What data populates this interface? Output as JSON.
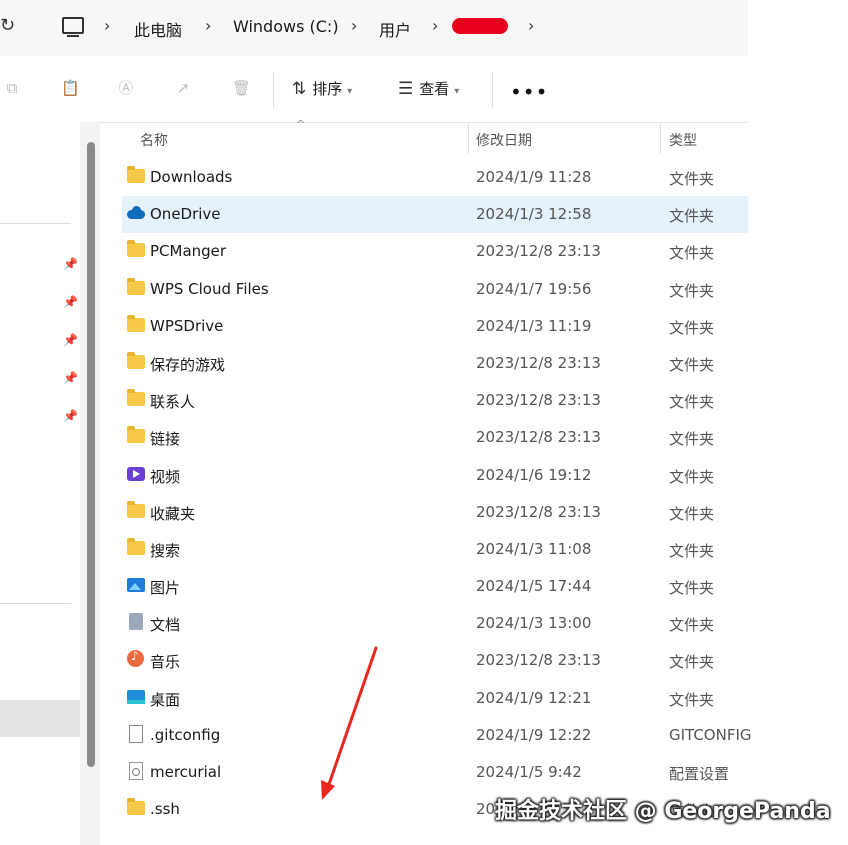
{
  "breadcrumb": {
    "items": [
      "此电脑",
      "Windows (C:)",
      "用户"
    ],
    "redacted_segment": "(redacted)"
  },
  "toolbar": {
    "sort_label": "排序",
    "view_label": "查看",
    "more_label": "•••"
  },
  "columns": {
    "name": "名称",
    "date": "修改日期",
    "type": "类型"
  },
  "files": [
    {
      "icon": "folder-icon",
      "name": "Downloads",
      "date": "2024/1/9 11:28",
      "type": "文件夹"
    },
    {
      "icon": "onedrive-icon",
      "name": "OneDrive",
      "date": "2024/1/3 12:58",
      "type": "文件夹",
      "selected": true
    },
    {
      "icon": "folder-icon",
      "name": "PCManger",
      "date": "2023/12/8 23:13",
      "type": "文件夹"
    },
    {
      "icon": "folder-icon",
      "name": "WPS Cloud Files",
      "date": "2024/1/7 19:56",
      "type": "文件夹"
    },
    {
      "icon": "folder-icon",
      "name": "WPSDrive",
      "date": "2024/1/3 11:19",
      "type": "文件夹"
    },
    {
      "icon": "folder-icon",
      "name": "保存的游戏",
      "date": "2023/12/8 23:13",
      "type": "文件夹"
    },
    {
      "icon": "folder-icon",
      "name": "联系人",
      "date": "2023/12/8 23:13",
      "type": "文件夹"
    },
    {
      "icon": "folder-icon",
      "name": "链接",
      "date": "2023/12/8 23:13",
      "type": "文件夹"
    },
    {
      "icon": "video-icon",
      "name": "视频",
      "date": "2024/1/6 19:12",
      "type": "文件夹"
    },
    {
      "icon": "folder-icon",
      "name": "收藏夹",
      "date": "2023/12/8 23:13",
      "type": "文件夹"
    },
    {
      "icon": "folder-icon",
      "name": "搜索",
      "date": "2024/1/3 11:08",
      "type": "文件夹"
    },
    {
      "icon": "picture-icon",
      "name": "图片",
      "date": "2024/1/5 17:44",
      "type": "文件夹"
    },
    {
      "icon": "document-icon",
      "name": "文档",
      "date": "2024/1/3 13:00",
      "type": "文件夹"
    },
    {
      "icon": "music-icon",
      "name": "音乐",
      "date": "2023/12/8 23:13",
      "type": "文件夹"
    },
    {
      "icon": "desktop-icon",
      "name": "桌面",
      "date": "2024/1/9 12:21",
      "type": "文件夹"
    },
    {
      "icon": "file-icon",
      "name": ".gitconfig",
      "date": "2024/1/9 12:22",
      "type": "GITCONFIG"
    },
    {
      "icon": "config-icon",
      "name": "mercurial",
      "date": "2024/1/5 9:42",
      "type": "配置设置"
    },
    {
      "icon": "folder-icon",
      "name": ".ssh",
      "date": "20",
      "type": "文件夹"
    }
  ],
  "watermark": "掘金技术社区 @ GeorgePanda",
  "colors": {
    "selected_row": "#e5f1fb",
    "folder": "#f7c948",
    "annotation_arrow": "#e8251e"
  }
}
